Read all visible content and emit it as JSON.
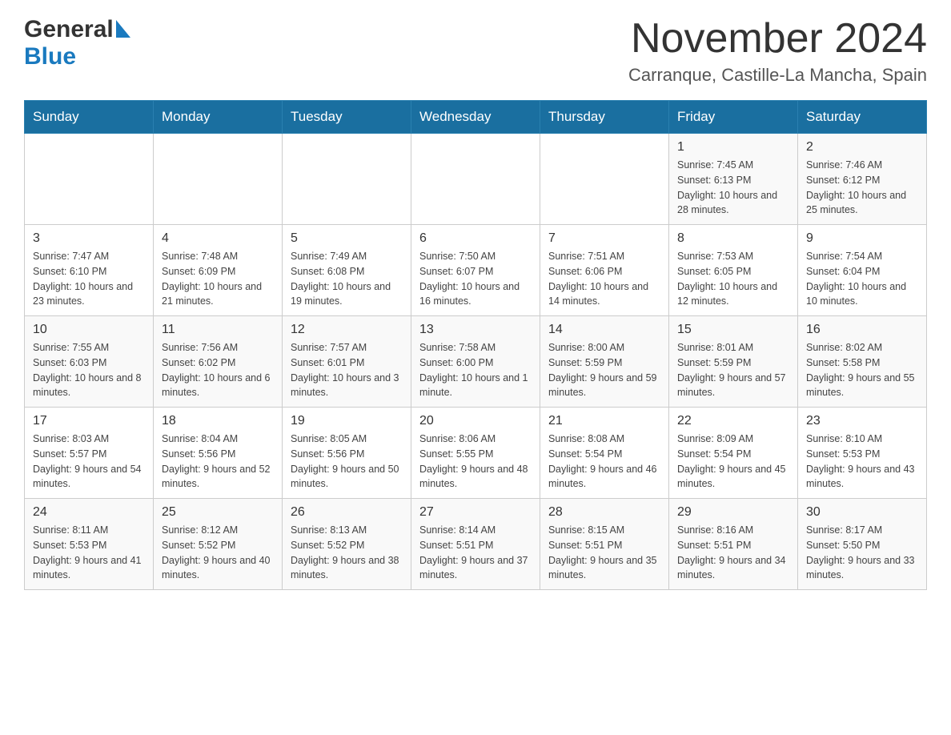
{
  "header": {
    "logo_general": "General",
    "logo_blue": "Blue",
    "title": "November 2024",
    "subtitle": "Carranque, Castille-La Mancha, Spain"
  },
  "days_of_week": [
    "Sunday",
    "Monday",
    "Tuesday",
    "Wednesday",
    "Thursday",
    "Friday",
    "Saturday"
  ],
  "weeks": [
    [
      {
        "day": "",
        "sunrise": "",
        "sunset": "",
        "daylight": ""
      },
      {
        "day": "",
        "sunrise": "",
        "sunset": "",
        "daylight": ""
      },
      {
        "day": "",
        "sunrise": "",
        "sunset": "",
        "daylight": ""
      },
      {
        "day": "",
        "sunrise": "",
        "sunset": "",
        "daylight": ""
      },
      {
        "day": "",
        "sunrise": "",
        "sunset": "",
        "daylight": ""
      },
      {
        "day": "1",
        "sunrise": "Sunrise: 7:45 AM",
        "sunset": "Sunset: 6:13 PM",
        "daylight": "Daylight: 10 hours and 28 minutes."
      },
      {
        "day": "2",
        "sunrise": "Sunrise: 7:46 AM",
        "sunset": "Sunset: 6:12 PM",
        "daylight": "Daylight: 10 hours and 25 minutes."
      }
    ],
    [
      {
        "day": "3",
        "sunrise": "Sunrise: 7:47 AM",
        "sunset": "Sunset: 6:10 PM",
        "daylight": "Daylight: 10 hours and 23 minutes."
      },
      {
        "day": "4",
        "sunrise": "Sunrise: 7:48 AM",
        "sunset": "Sunset: 6:09 PM",
        "daylight": "Daylight: 10 hours and 21 minutes."
      },
      {
        "day": "5",
        "sunrise": "Sunrise: 7:49 AM",
        "sunset": "Sunset: 6:08 PM",
        "daylight": "Daylight: 10 hours and 19 minutes."
      },
      {
        "day": "6",
        "sunrise": "Sunrise: 7:50 AM",
        "sunset": "Sunset: 6:07 PM",
        "daylight": "Daylight: 10 hours and 16 minutes."
      },
      {
        "day": "7",
        "sunrise": "Sunrise: 7:51 AM",
        "sunset": "Sunset: 6:06 PM",
        "daylight": "Daylight: 10 hours and 14 minutes."
      },
      {
        "day": "8",
        "sunrise": "Sunrise: 7:53 AM",
        "sunset": "Sunset: 6:05 PM",
        "daylight": "Daylight: 10 hours and 12 minutes."
      },
      {
        "day": "9",
        "sunrise": "Sunrise: 7:54 AM",
        "sunset": "Sunset: 6:04 PM",
        "daylight": "Daylight: 10 hours and 10 minutes."
      }
    ],
    [
      {
        "day": "10",
        "sunrise": "Sunrise: 7:55 AM",
        "sunset": "Sunset: 6:03 PM",
        "daylight": "Daylight: 10 hours and 8 minutes."
      },
      {
        "day": "11",
        "sunrise": "Sunrise: 7:56 AM",
        "sunset": "Sunset: 6:02 PM",
        "daylight": "Daylight: 10 hours and 6 minutes."
      },
      {
        "day": "12",
        "sunrise": "Sunrise: 7:57 AM",
        "sunset": "Sunset: 6:01 PM",
        "daylight": "Daylight: 10 hours and 3 minutes."
      },
      {
        "day": "13",
        "sunrise": "Sunrise: 7:58 AM",
        "sunset": "Sunset: 6:00 PM",
        "daylight": "Daylight: 10 hours and 1 minute."
      },
      {
        "day": "14",
        "sunrise": "Sunrise: 8:00 AM",
        "sunset": "Sunset: 5:59 PM",
        "daylight": "Daylight: 9 hours and 59 minutes."
      },
      {
        "day": "15",
        "sunrise": "Sunrise: 8:01 AM",
        "sunset": "Sunset: 5:59 PM",
        "daylight": "Daylight: 9 hours and 57 minutes."
      },
      {
        "day": "16",
        "sunrise": "Sunrise: 8:02 AM",
        "sunset": "Sunset: 5:58 PM",
        "daylight": "Daylight: 9 hours and 55 minutes."
      }
    ],
    [
      {
        "day": "17",
        "sunrise": "Sunrise: 8:03 AM",
        "sunset": "Sunset: 5:57 PM",
        "daylight": "Daylight: 9 hours and 54 minutes."
      },
      {
        "day": "18",
        "sunrise": "Sunrise: 8:04 AM",
        "sunset": "Sunset: 5:56 PM",
        "daylight": "Daylight: 9 hours and 52 minutes."
      },
      {
        "day": "19",
        "sunrise": "Sunrise: 8:05 AM",
        "sunset": "Sunset: 5:56 PM",
        "daylight": "Daylight: 9 hours and 50 minutes."
      },
      {
        "day": "20",
        "sunrise": "Sunrise: 8:06 AM",
        "sunset": "Sunset: 5:55 PM",
        "daylight": "Daylight: 9 hours and 48 minutes."
      },
      {
        "day": "21",
        "sunrise": "Sunrise: 8:08 AM",
        "sunset": "Sunset: 5:54 PM",
        "daylight": "Daylight: 9 hours and 46 minutes."
      },
      {
        "day": "22",
        "sunrise": "Sunrise: 8:09 AM",
        "sunset": "Sunset: 5:54 PM",
        "daylight": "Daylight: 9 hours and 45 minutes."
      },
      {
        "day": "23",
        "sunrise": "Sunrise: 8:10 AM",
        "sunset": "Sunset: 5:53 PM",
        "daylight": "Daylight: 9 hours and 43 minutes."
      }
    ],
    [
      {
        "day": "24",
        "sunrise": "Sunrise: 8:11 AM",
        "sunset": "Sunset: 5:53 PM",
        "daylight": "Daylight: 9 hours and 41 minutes."
      },
      {
        "day": "25",
        "sunrise": "Sunrise: 8:12 AM",
        "sunset": "Sunset: 5:52 PM",
        "daylight": "Daylight: 9 hours and 40 minutes."
      },
      {
        "day": "26",
        "sunrise": "Sunrise: 8:13 AM",
        "sunset": "Sunset: 5:52 PM",
        "daylight": "Daylight: 9 hours and 38 minutes."
      },
      {
        "day": "27",
        "sunrise": "Sunrise: 8:14 AM",
        "sunset": "Sunset: 5:51 PM",
        "daylight": "Daylight: 9 hours and 37 minutes."
      },
      {
        "day": "28",
        "sunrise": "Sunrise: 8:15 AM",
        "sunset": "Sunset: 5:51 PM",
        "daylight": "Daylight: 9 hours and 35 minutes."
      },
      {
        "day": "29",
        "sunrise": "Sunrise: 8:16 AM",
        "sunset": "Sunset: 5:51 PM",
        "daylight": "Daylight: 9 hours and 34 minutes."
      },
      {
        "day": "30",
        "sunrise": "Sunrise: 8:17 AM",
        "sunset": "Sunset: 5:50 PM",
        "daylight": "Daylight: 9 hours and 33 minutes."
      }
    ]
  ]
}
